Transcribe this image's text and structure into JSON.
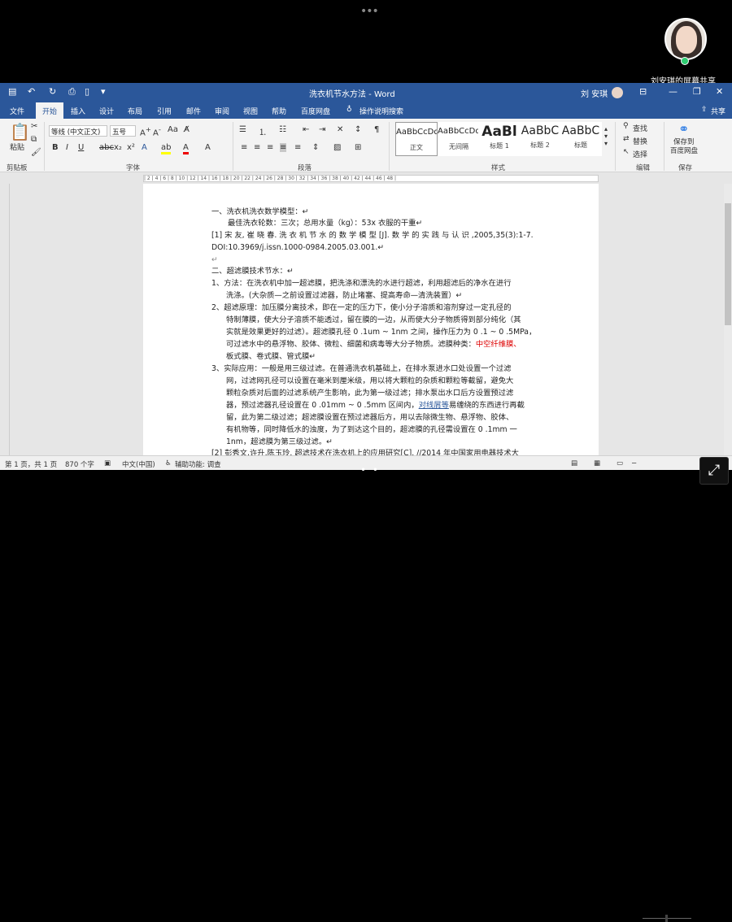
{
  "screen_share": {
    "dots": "•••",
    "presenter": "刘安琪的屏幕共享"
  },
  "window": {
    "title": "洗衣机节水方法 - Word",
    "user": "刘 安琪"
  },
  "tabs": [
    "文件",
    "开始",
    "插入",
    "设计",
    "布局",
    "引用",
    "邮件",
    "审阅",
    "视图",
    "帮助",
    "百度网盘",
    "操作说明搜索"
  ],
  "share_label": "共享",
  "ribbon": {
    "paste": "粘贴",
    "clipboard": "剪贴板",
    "font_name": "等线 (中文正文)",
    "font_size": "五号",
    "font_group": "字体",
    "para_group": "段落",
    "styles": [
      {
        "sample": "AaBbCcDd",
        "name": "正文"
      },
      {
        "sample": "AaBbCcDd",
        "name": "无间隔"
      },
      {
        "sample": "AaBl",
        "name": "标题 1"
      },
      {
        "sample": "AaBbC",
        "name": "标题 2"
      },
      {
        "sample": "AaBbC",
        "name": "标题"
      }
    ],
    "style_group": "样式",
    "find": "查找",
    "replace": "替换",
    "select": "选择",
    "edit_group": "编辑",
    "save_baidu": "保存到",
    "save_baidu2": "百度网盘",
    "save_group": "保存"
  },
  "ruler": "| 2 | 4 | 6 | 8 | 10 | 12 | 14 | 16 | 18 | 20 | 22 | 24 | 26 | 28 | 30 | 32 | 34 | 36 | 38 | 40 | 42 | 44 | 46 | 48 |",
  "doc": {
    "l1": "一、洗衣机洗衣数学模型：↵",
    "l2": "最佳洗衣轮数：三次；总用水量（kg）：53x 衣服的干重↵",
    "l3": "[1] 宋 友, 崔 晓 春. 洗 衣 机 节 水 的 数 学 模 型 [J]. 数 学 的 实 践 与 认 识 ,2005,35(3):1-7.",
    "l4": "DOI:10.3969/j.issn.1000-0984.2005.03.001.↵",
    "l5": "↵",
    "l6": "二、超滤膜技术节水：↵",
    "l7": "1、方法：在洗衣机中加一超滤膜，把洗涤和漂洗的水进行超滤，利用超滤后的净水在进行",
    "l8": "洗涤。(大杂质—之前设置过滤器，防止堵塞、提高寿命—清洗装置）↵",
    "l9": "2、超滤原理：加压膜分离技术，即在一定的压力下，使小分子溶质和溶剂穿过一定孔径的",
    "l10": "特制薄膜，使大分子溶质不能透过，留在膜的一边，从而使大分子物质得到部分纯化（其",
    "l11": "实就是效果更好的过滤）。超滤膜孔径 0 .1um ~ 1nm 之间，操作压力为 0 .1 ~ 0 .5MPa，",
    "l12a": "可过滤水中的悬浮物、胶体、微粒、细菌和病毒等大分子物质。滤膜种类：",
    "l12b": "中空纤维膜、",
    "l13": "板式膜、卷式膜、管式膜↵",
    "l14": "3、实际应用：一般是用三级过滤。在普通洗衣机基础上，在排水泵进水口处设置一个过滤",
    "l15": "网，过滤网孔径可以设置在毫米到厘米级，用以将大颗粒的杂质和颗粒等截留，避免大",
    "l16": "颗粒杂质对后面的过滤系统产生影响，此为第一级过滤；排水泵出水口后方设置预过滤",
    "l17a": "器，预过滤器孔径设置在 0 .01mm ~ 0 .5mm 区间内，",
    "l17b": "对线屑等",
    "l17c": "易缠绕的东西进行再截",
    "l18": "留，此为第二级过滤；超滤膜设置在预过滤器后方，用以去除微生物、悬浮物、胶体、",
    "l19": "有机物等，同时降低水的浊度，为了到达这个目的，超滤膜的孔径需设置在 0 .1mm 一",
    "l20": "1nm，超滤膜为第三级过滤。↵",
    "l21": "[2]  彭秀文,许升,陈玉玲. 超滤技术在洗衣机上的应用研究[C]. //2014 年中国家用电器技术大"
  },
  "status": {
    "page": "第 1 页，共 1 页",
    "words": "870 个字",
    "lang": "中文(中国)",
    "access": "辅助功能: 调查"
  },
  "page_dots": "• •"
}
